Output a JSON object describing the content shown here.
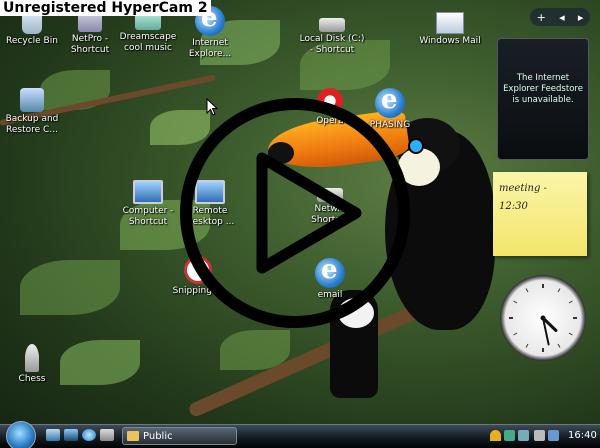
{
  "watermark": "Unregistered HyperCam 2",
  "desktop_icons": {
    "recycle_bin": [
      "Recycle Bin"
    ],
    "netpro": [
      "NetPro -",
      "Shortcut"
    ],
    "dreamscape": [
      "Dreamscape",
      "cool music"
    ],
    "internet_explorer": [
      "Internet",
      "Explore..."
    ],
    "local_disk": [
      "Local Disk (C:)",
      "- Shortcut"
    ],
    "windows_mail": [
      "Windows Mail"
    ],
    "backup_restore": [
      "Backup and",
      "Restore C..."
    ],
    "opera": [
      "Opera"
    ],
    "phasing": [
      "PHASING"
    ],
    "computer_shortcut": [
      "Computer -",
      "Shortcut"
    ],
    "remote_desktop": [
      "Remote",
      "Desktop ..."
    ],
    "network_shortcut": [
      "Netw...",
      "Shortc..."
    ],
    "snipping": [
      "Snipping ..."
    ],
    "email": [
      "email"
    ],
    "chess": [
      "Chess"
    ]
  },
  "sidebar": {
    "controls": [
      "+",
      "◂",
      "▸"
    ],
    "feed_message": "The Internet Explorer Feedstore is unavailable.",
    "note_lines": [
      "meeting -",
      "12:30"
    ],
    "clock": {
      "hour": 4,
      "minute": 28
    }
  },
  "taskbar": {
    "window_button": "Public",
    "time": "16:40"
  }
}
